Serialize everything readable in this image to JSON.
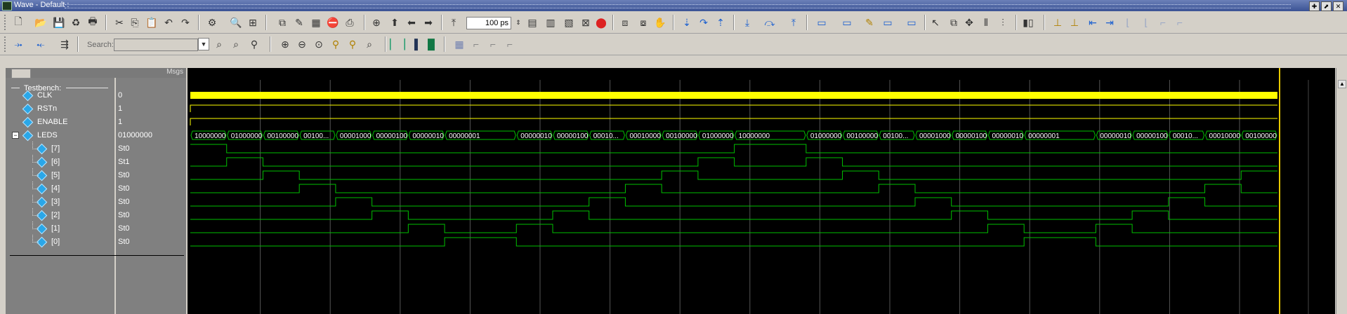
{
  "window": {
    "title": "Wave - Default :"
  },
  "toolbar": {
    "zoom_value": "100 ps",
    "search_label": "Search:",
    "search_value": ""
  },
  "panes": {
    "msgs_header": "Msgs"
  },
  "group": {
    "label": "Testbench:"
  },
  "signals": [
    {
      "name": "CLK",
      "value": "0"
    },
    {
      "name": "RSTn",
      "value": "1"
    },
    {
      "name": "ENABLE",
      "value": "1"
    },
    {
      "name": "LEDS",
      "value": "01000000"
    },
    {
      "name": "[7]",
      "value": "St0"
    },
    {
      "name": "[6]",
      "value": "St1"
    },
    {
      "name": "[5]",
      "value": "St0"
    },
    {
      "name": "[4]",
      "value": "St0"
    },
    {
      "name": "[3]",
      "value": "St0"
    },
    {
      "name": "[2]",
      "value": "St0"
    },
    {
      "name": "[1]",
      "value": "St0"
    },
    {
      "name": "[0]",
      "value": "St0"
    }
  ],
  "bus_values": [
    "10000000",
    "01000000",
    "00100000",
    "00100...",
    "00001000",
    "00000100",
    "00000010",
    "00000001",
    "00000010",
    "00000100",
    "00010...",
    "00010000",
    "00100000",
    "01000000",
    "10000000",
    "01000000",
    "00100000",
    "00100...",
    "00001000",
    "00000100",
    "00000010",
    "00000001",
    "00000010",
    "00000100",
    "00010...",
    "00010000",
    "00100000"
  ],
  "bus_bit_index": [
    7,
    6,
    5,
    4,
    3,
    2,
    1,
    0,
    1,
    2,
    3,
    4,
    5,
    6,
    7,
    6,
    5,
    4,
    3,
    2,
    1,
    0,
    1,
    2,
    3,
    4,
    5
  ],
  "colors": {
    "clock": "#ffff00",
    "wave": "#00c000",
    "cursor": "#e8c800",
    "grid": "#3a3a3a",
    "sel_bg": "#000000"
  }
}
